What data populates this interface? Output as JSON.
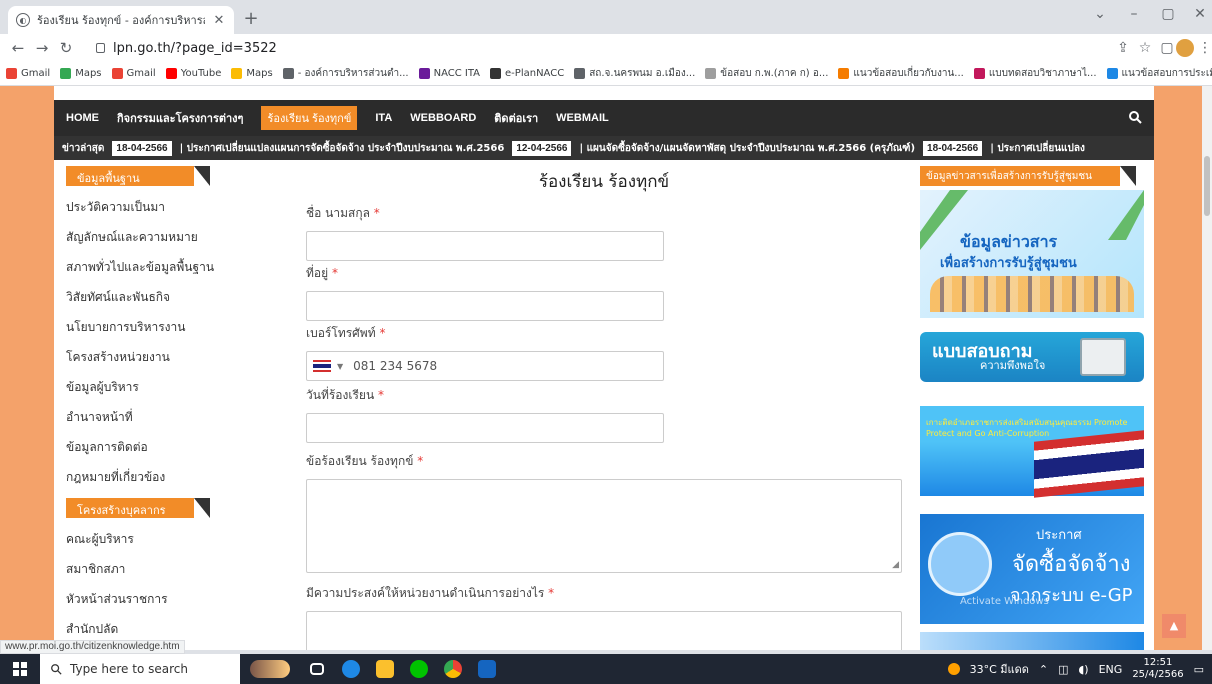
{
  "browser": {
    "tab_title": "ร้องเรียน ร้องทุกข์ - องค์การบริหารส่วน",
    "url": "lpn.go.th/?page_id=3522",
    "status_url": "www.pr.moi.go.th/citizenknowledge.htm"
  },
  "bookmarks": [
    {
      "label": "Gmail",
      "icon": "gmail-icon",
      "color": "#ea4335"
    },
    {
      "label": "Maps",
      "icon": "maps-icon",
      "color": "#34a853"
    },
    {
      "label": "Gmail",
      "icon": "gmail-icon",
      "color": "#ea4335"
    },
    {
      "label": "YouTube",
      "icon": "youtube-icon",
      "color": "#ff0000"
    },
    {
      "label": "Maps",
      "icon": "maps-icon",
      "color": "#fbbc04"
    },
    {
      "label": "- องค์การบริหารส่วนตำ...",
      "icon": "globe-icon",
      "color": "#5f6368"
    },
    {
      "label": "NACC ITA",
      "icon": "nacc-icon",
      "color": "#6a1b9a"
    },
    {
      "label": "e-PlanNACC",
      "icon": "home-icon",
      "color": "#333333"
    },
    {
      "label": "สถ.จ.นครพนม อ.เมือง...",
      "icon": "globe-icon",
      "color": "#5f6368"
    },
    {
      "label": "ข้อสอบ ก.พ.(ภาค ก) อ...",
      "icon": "globe-icon",
      "color": "#9e9e9e"
    },
    {
      "label": "แนวข้อสอบเกี่ยวกับงาน...",
      "icon": "bookmark-icon",
      "color": "#f57c00"
    },
    {
      "label": "แบบทดสอบวิชาภาษาไ...",
      "icon": "bookmark-icon",
      "color": "#c2185b"
    },
    {
      "label": "แนวข้อสอบการประเมิน...",
      "icon": "bookmark-icon",
      "color": "#1e88e5"
    }
  ],
  "nav": {
    "items": [
      "HOME",
      "กิจกรรมและโครงการต่างๆ",
      "ร้องเรียน ร้องทุกข์",
      "ITA",
      "WEBBOARD",
      "ติดต่อเรา",
      "WEBMAIL"
    ],
    "active_index": 2
  },
  "ticker": {
    "label": "ข่าวล่าสุด",
    "items": [
      {
        "date": "18-04-2566",
        "text": "| ประกาศเปลี่ยนแปลงแผนการจัดซื้อจัดจ้าง ประจำปีงบประมาณ พ.ศ.2566"
      },
      {
        "date": "12-04-2566",
        "text": "| แผนจัดซื้อจัดจ้าง/แผนจัดหาพัสดุ ประจำปีงบประมาณ พ.ศ.2566 (ครุภัณฑ์)"
      },
      {
        "date": "18-04-2566",
        "text": "| ประกาศเปลี่ยนแปลง"
      }
    ]
  },
  "left_sidebar": {
    "section1_title": "ข้อมูลพื้นฐาน",
    "section1_items": [
      "ประวัติความเป็นมา",
      "สัญลักษณ์และความหมาย",
      "สภาพทั่วไปและข้อมูลพื้นฐาน",
      "วิสัยทัศน์และพันธกิจ",
      "นโยบายการบริหารงาน",
      "โครงสร้างหน่วยงาน",
      "ข้อมูลผู้บริหาร",
      "อำนาจหน้าที่",
      "ข้อมูลการติดต่อ",
      "กฎหมายที่เกี่ยวข้อง"
    ],
    "section2_title": "โครงสร้างบุคลากร",
    "section2_items": [
      "คณะผู้บริหาร",
      "สมาชิกสภา",
      "หัวหน้าส่วนราชการ",
      "สำนักปลัด"
    ]
  },
  "form": {
    "title": "ร้องเรียน ร้องทุกข์",
    "required_mark": "*",
    "name_label": "ชื่อ นามสกุล",
    "address_label": "ที่อยู่",
    "phone_label": "เบอร์โทรศัพท์",
    "phone_placeholder": "081 234 5678",
    "date_label": "วันที่ร้องเรียน",
    "complaint_label": "ข้อร้องเรียน ร้องทุกข์",
    "request_label": "มีความประสงค์ให้หน่วยงานดำเนินการอย่างไร"
  },
  "right_sidebar": {
    "title": "ข้อมูลข่าวสารเพื่อสร้างการรับรู้สู่ชุมชน",
    "banner1_line1": "ข้อมูลข่าวสาร",
    "banner1_line2": "เพื่อสร้างการรับรู้สู่ชุมชน",
    "banner2_line1": "แบบสอบถาม",
    "banner2_line2": "ความพึงพอใจ",
    "banner3_text": "เกาะติดอำเภอราชการส่งเสริมสนับสนุนคุณธรรม Promote Protect and Go Anti-Corruption",
    "banner4_line1": "ประกาศ",
    "banner4_line2": "จัดซื้อจัดจ้าง",
    "banner4_line3": "จากระบบ e-GP",
    "banner4_watermark": "Activate Windows"
  },
  "taskbar": {
    "search_placeholder": "Type here to search",
    "weather": "33°C มีแดด",
    "lang": "ENG",
    "time": "12:51",
    "date": "25/4/2566"
  }
}
